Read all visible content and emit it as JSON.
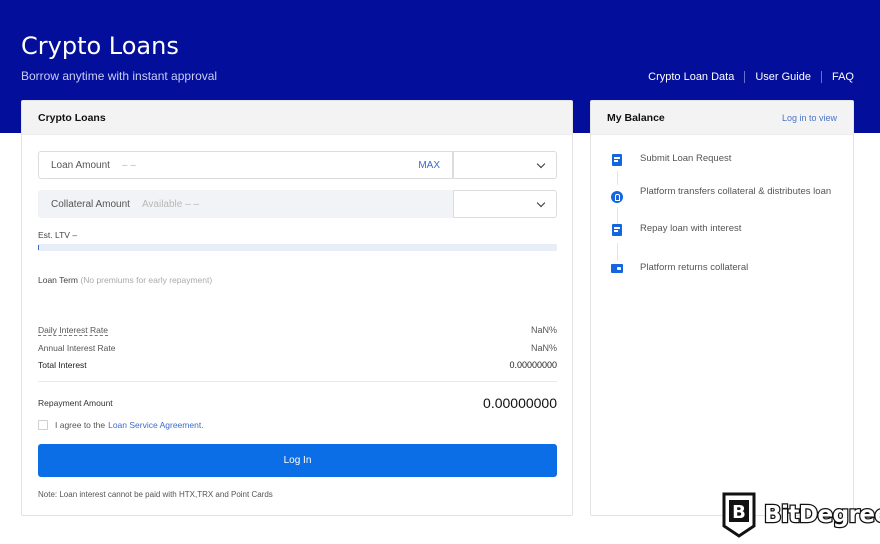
{
  "header": {
    "title": "Crypto Loans",
    "subtitle": "Borrow anytime with instant approval",
    "links": [
      "Crypto Loan Data",
      "User Guide",
      "FAQ"
    ]
  },
  "loan_panel": {
    "title": "Crypto Loans",
    "loan_amount": {
      "label": "Loan Amount",
      "placeholder": "– –",
      "max_label": "MAX",
      "currency": ""
    },
    "collateral_amount": {
      "label": "Collateral Amount",
      "available": "Available – –",
      "currency": ""
    },
    "ltv": {
      "label": "Est. LTV –",
      "progress_percent": 0
    },
    "loan_term": {
      "label": "Loan Term",
      "hint": "(No premiums for early repayment)"
    },
    "rates": [
      {
        "label": "Daily Interest Rate",
        "value": "NaN%"
      },
      {
        "label": "Annual Interest Rate",
        "value": "NaN%"
      },
      {
        "label": "Total Interest",
        "value": "0.00000000"
      }
    ],
    "repayment": {
      "label": "Repayment Amount",
      "value": "0.00000000"
    },
    "agreement": {
      "prefix": "I agree to the",
      "link": "Loan Service Agreement.",
      "checked": false
    },
    "login_button": "Log In",
    "note": "Note: Loan interest cannot be paid with HTX,TRX and Point Cards"
  },
  "balance_panel": {
    "title": "My Balance",
    "login_link": "Log in to view",
    "steps": [
      {
        "icon": "document-icon",
        "text": "Submit Loan Request"
      },
      {
        "icon": "transfer-icon",
        "text": "Platform transfers collateral & distributes loan"
      },
      {
        "icon": "repay-icon",
        "text": "Repay loan with interest"
      },
      {
        "icon": "wallet-icon",
        "text": "Platform returns collateral"
      }
    ]
  },
  "watermark": {
    "text": "BitDegree"
  },
  "colors": {
    "header_bg": "#030e9a",
    "primary": "#0b6ee6",
    "link": "#3a6cc9"
  }
}
